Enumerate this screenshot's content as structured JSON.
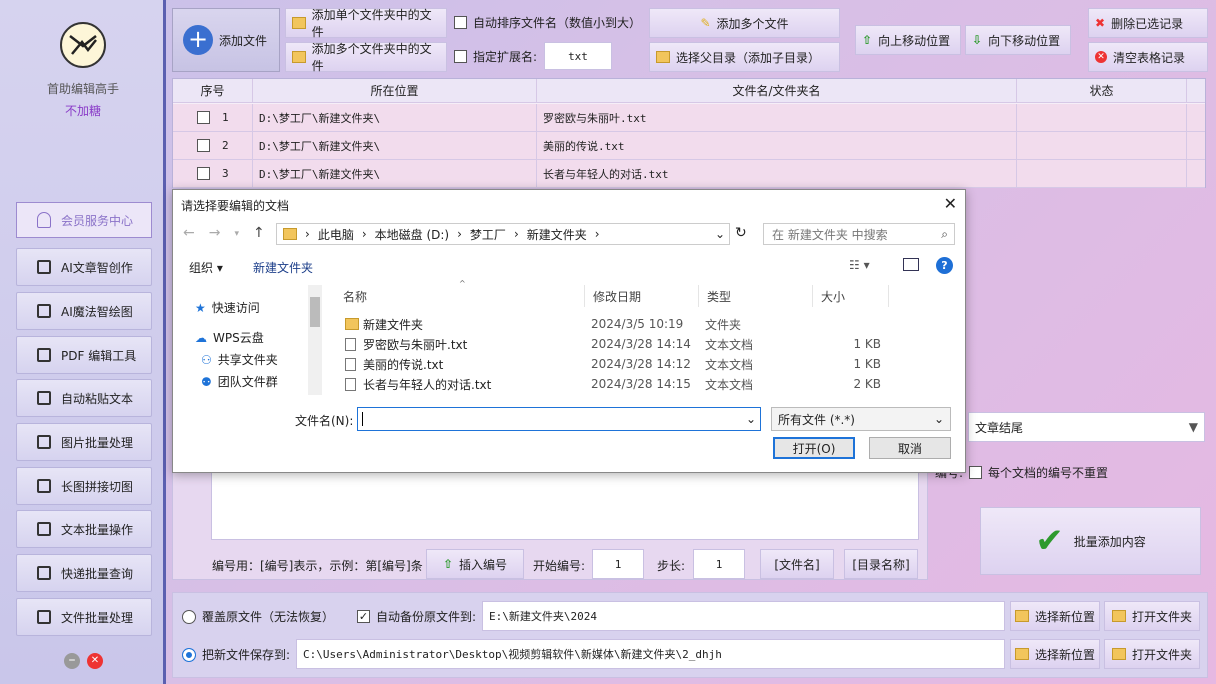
{
  "sidebar": {
    "app_name": "首助编辑高手",
    "app_subtitle": "不加糖",
    "member_label": "会员服务中心",
    "items": [
      {
        "label": "AI文章智创作",
        "icon": "list-icon"
      },
      {
        "label": "AI魔法智绘图",
        "icon": "brush-icon"
      },
      {
        "label": "PDF 编辑工具",
        "icon": "pdf-icon"
      },
      {
        "label": "自动粘贴文本",
        "icon": "paste-icon"
      },
      {
        "label": "图片批量处理",
        "icon": "image-icon"
      },
      {
        "label": "长图拼接切图",
        "icon": "crop-icon"
      },
      {
        "label": "文本批量操作",
        "icon": "text-icon"
      },
      {
        "label": "快递批量查询",
        "icon": "truck-icon"
      },
      {
        "label": "文件批量处理",
        "icon": "file-edit-icon"
      }
    ]
  },
  "toolbar": {
    "add_file": "添加文件",
    "add_single_folder": "添加单个文件夹中的文件",
    "add_multi_folder": "添加多个文件夹中的文件",
    "auto_sort": "自动排序文件名（数值小到大）",
    "ext_label": "指定扩展名:",
    "ext_value": "txt",
    "add_multi_files": "添加多个文件",
    "select_parent": "选择父目录（添加子目录）",
    "move_up": "向上移动位置",
    "move_down": "向下移动位置",
    "delete_selected": "删除已选记录",
    "clear_table": "清空表格记录"
  },
  "table": {
    "headers": [
      "序号",
      "所在位置",
      "文件名/文件夹名",
      "状态"
    ],
    "rows": [
      {
        "no": "1",
        "location": "D:\\梦工厂\\新建文件夹\\",
        "name": "罗密欧与朱丽叶.txt",
        "status": ""
      },
      {
        "no": "2",
        "location": "D:\\梦工厂\\新建文件夹\\",
        "name": "美丽的传说.txt",
        "status": ""
      },
      {
        "no": "3",
        "location": "D:\\梦工厂\\新建文件夹\\",
        "name": "长者与年轻人的对话.txt",
        "status": ""
      }
    ]
  },
  "dialog": {
    "title": "请选择要编辑的文档",
    "breadcrumb": [
      "此电脑",
      "本地磁盘 (D:)",
      "梦工厂",
      "新建文件夹"
    ],
    "search_placeholder": "在 新建文件夹 中搜索",
    "organize": "组织 ▾",
    "new_folder": "新建文件夹",
    "nav": [
      "快速访问",
      "WPS云盘",
      "共享文件夹",
      "团队文件群"
    ],
    "columns": [
      "名称",
      "修改日期",
      "类型",
      "大小"
    ],
    "files": [
      {
        "name": "新建文件夹",
        "date": "2024/3/5 10:19",
        "type": "文件夹",
        "size": "",
        "icon": "folder-icon"
      },
      {
        "name": "罗密欧与朱丽叶.txt",
        "date": "2024/3/28 14:14",
        "type": "文本文档",
        "size": "1 KB",
        "icon": "text-file-icon"
      },
      {
        "name": "美丽的传说.txt",
        "date": "2024/3/28 14:12",
        "type": "文本文档",
        "size": "1 KB",
        "icon": "text-file-icon"
      },
      {
        "name": "长者与年轻人的对话.txt",
        "date": "2024/3/28 14:15",
        "type": "文本文档",
        "size": "2 KB",
        "icon": "text-file-icon"
      }
    ],
    "filename_label": "文件名(N):",
    "filename_value": "",
    "filter": "所有文件 (*.*)",
    "open": "打开(O)",
    "cancel": "取消"
  },
  "options": {
    "position_select": "文章结尾",
    "numbering_prefix": "编号:",
    "unique_number": "每个文档的编号不重置",
    "batch_add": "批量添加内容",
    "numbering_hint": "编号用：[编号]表示，示例：第[编号]条",
    "insert_number": "插入编号",
    "start_label": "开始编号:",
    "start_value": "1",
    "step_label": "步长:",
    "step_value": "1",
    "filename_tag": "[文件名]",
    "dirname_tag": "[目录名称]"
  },
  "output": {
    "overwrite": "覆盖原文件（无法恢复）",
    "backup_label": "自动备份原文件到:",
    "backup_path": "E:\\新建文件夹\\2024",
    "save_new": "把新文件保存到:",
    "save_path": "C:\\Users\\Administrator\\Desktop\\视频剪辑软件\\新媒体\\新建文件夹\\2_dhjh",
    "choose_location": "选择新位置",
    "open_folder": "打开文件夹"
  },
  "colors": {
    "accent": "#5b5fb0",
    "member": "#8a72c8",
    "check_green": "#2e9a2e",
    "delete_red": "#e33333"
  }
}
